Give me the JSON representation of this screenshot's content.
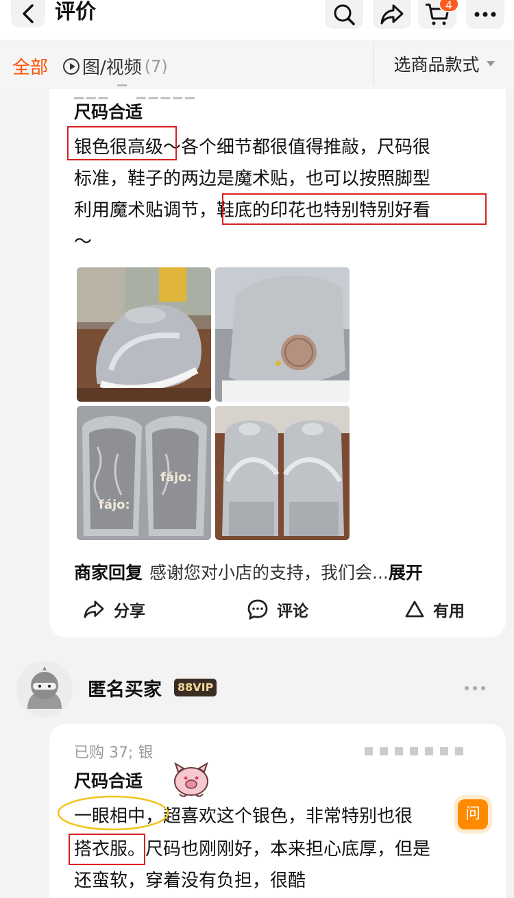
{
  "header": {
    "title": "评价",
    "cart_count": "4"
  },
  "filter": {
    "tab_all": "全部",
    "tab_media": "图/视频",
    "tab_media_count": "(7)",
    "style_select": "选商品款式"
  },
  "review1": {
    "tag": "尺码合适",
    "line1_hl": "银色很高级",
    "line1_rest": "～各个细节都很值得推敲，尺码很",
    "line2": "标准，鞋子的两边是魔术贴，也可以按照脚型",
    "line3_pre": "利用魔术贴调节，",
    "line3_hl": "鞋底的印花也特别特别好看",
    "line4": "～",
    "photos": [
      "shoe-photo-1",
      "shoe-photo-2",
      "shoe-photo-3",
      "shoe-photo-4"
    ],
    "insole_brand": "fájo:",
    "merchant_reply_label": "商家回复",
    "merchant_reply_text": "感谢您对小店的支持，我们会...",
    "expand_label": "展开",
    "share_label": "分享",
    "comment_label": "评论",
    "useful_label": "有用"
  },
  "review2": {
    "buyer_name": "匿名买家",
    "vip_badge": "88VIP",
    "purchased": "已购 37; 银",
    "tag": "尺码合适",
    "line1_hl": "一眼相中，",
    "line1_rest": "超喜欢这个银色，非常特别也很",
    "line2_hl": "搭衣服。",
    "line2_rest": "尺码也刚刚好，本来担心底厚，但是",
    "line3": "还蛮软，穿着没有负担，很酷"
  },
  "float": {
    "ask_label": "问"
  },
  "colors": {
    "accent": "#ff5000",
    "highlight_red": "#d92020",
    "highlight_yellow": "#f0c419"
  }
}
